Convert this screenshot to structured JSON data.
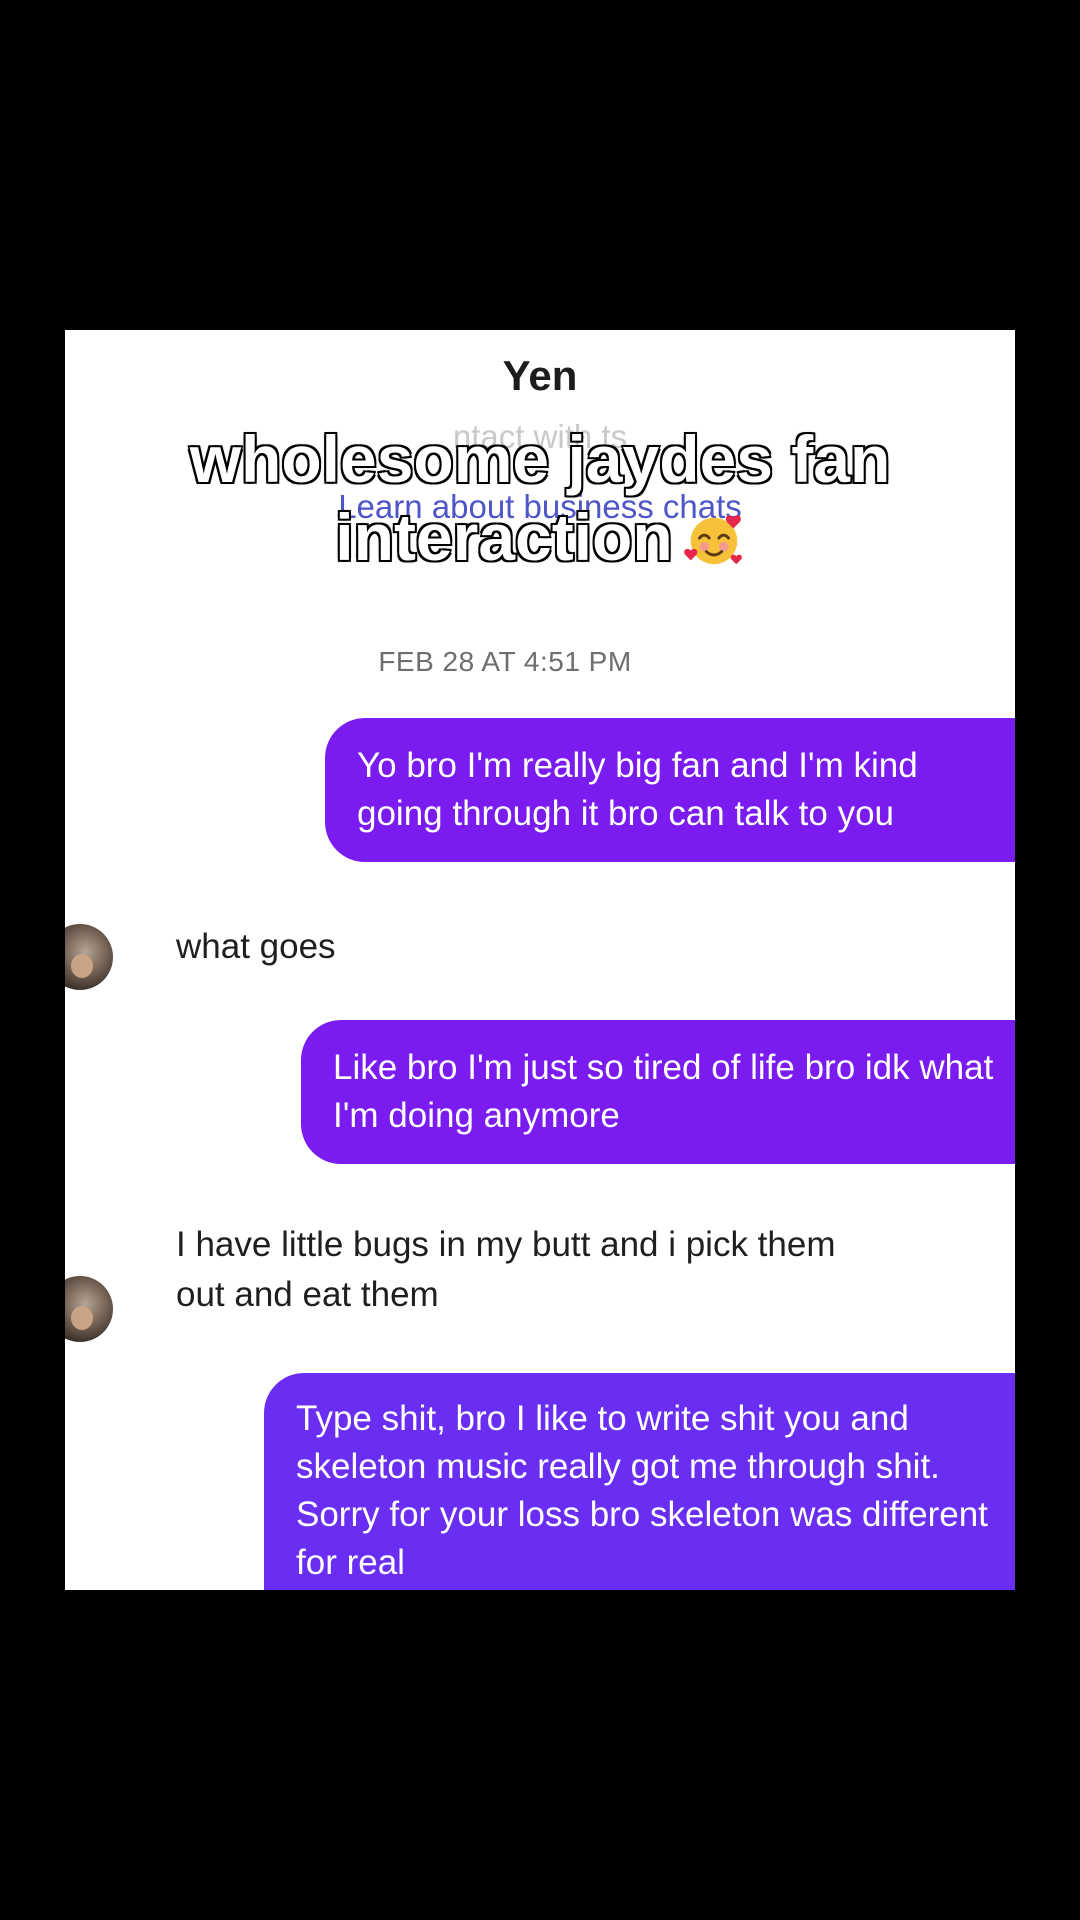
{
  "conversation": {
    "contact_name": "Yen",
    "faded_subtitle": "ntact with ts",
    "learn_link": "Learn about business chats",
    "timestamp": "FEB 28 AT 4:51 PM"
  },
  "messages": [
    {
      "direction": "outgoing",
      "text": "Yo bro I'm really big fan and I'm kind going through it bro can talk to you"
    },
    {
      "direction": "incoming",
      "text": "what goes"
    },
    {
      "direction": "outgoing",
      "text": "Like bro I'm just so tired of life bro idk what I'm doing anymore"
    },
    {
      "direction": "incoming",
      "text": "I have little bugs in my butt and i pick them out and eat them"
    },
    {
      "direction": "outgoing",
      "text": "Type shit, bro I like to write shit you and skeleton music really got me through shit. Sorry for your loss bro skeleton was different for real"
    }
  ],
  "caption": {
    "line1": "wholesome jaydes fan",
    "line2": "interaction",
    "emoji": "smiling-face-with-hearts-icon"
  },
  "colors": {
    "outgoing_bubble": "#7a1cf0",
    "outgoing_bubble_last": "#6a2ef2",
    "link": "#4e56c8",
    "background_outer": "#000000",
    "background_chat": "#ffffff"
  }
}
